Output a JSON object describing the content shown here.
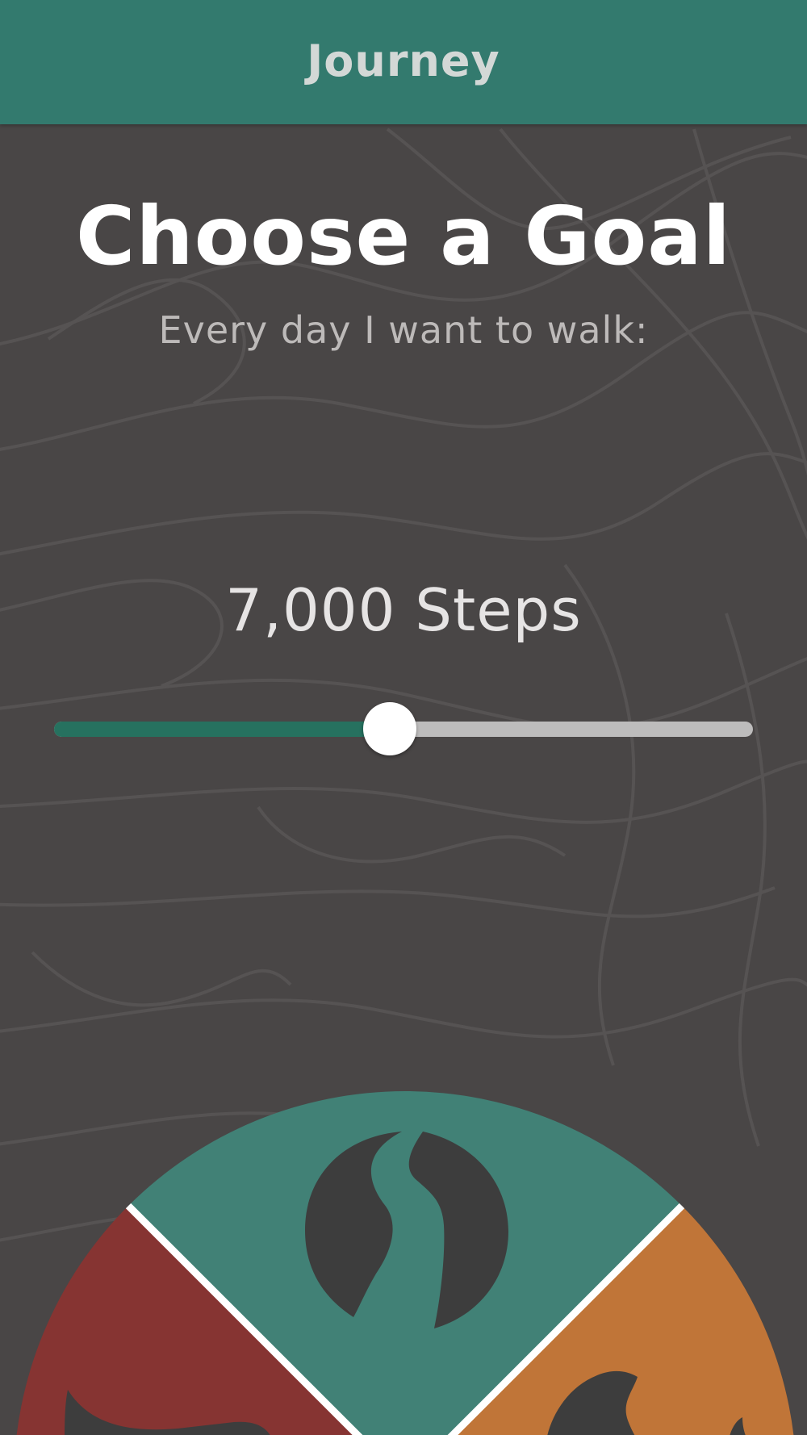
{
  "app_bar": {
    "title": "Journey"
  },
  "goal": {
    "heading": "Choose a Goal",
    "prompt": "Every day I want to walk:",
    "value_label": "7,000 Steps",
    "slider_fraction": 0.48
  },
  "wheel": {
    "segments": [
      {
        "name": "red",
        "color": "#863432",
        "icon": "shoe-icon"
      },
      {
        "name": "teal",
        "color": "#418176",
        "icon": "path-icon"
      },
      {
        "name": "orange",
        "color": "#c07538",
        "icon": "flame-icon"
      }
    ],
    "icon_color": "#3d3d3d",
    "divider_color": "#ffffff"
  },
  "colors": {
    "app_bar": "#337a6e",
    "background": "#494646",
    "slider_fill": "#26715f",
    "slider_track": "#bdbcbc"
  }
}
